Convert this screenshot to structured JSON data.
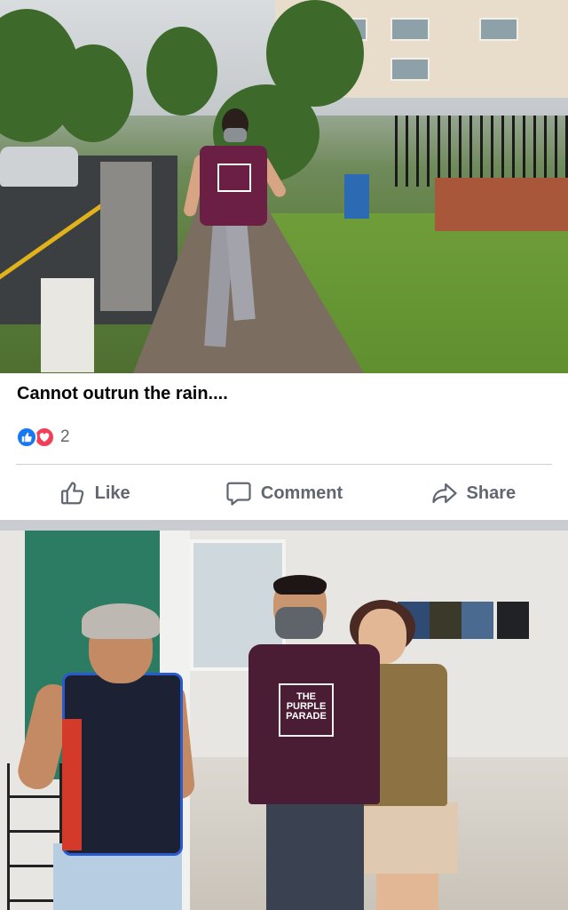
{
  "post": {
    "caption": "Cannot outrun the rain....",
    "reactions": {
      "types": [
        "like",
        "love"
      ],
      "count": "2"
    }
  },
  "actions": {
    "like_label": "Like",
    "comment_label": "Comment",
    "share_label": "Share"
  },
  "photos": {
    "shirt_text": "THE PURPLE PARADE"
  },
  "colors": {
    "like_blue": "#1877f2",
    "love_red": "#f33e58",
    "action_gray": "#606770",
    "divider": "#ced0d4",
    "separator": "#c9ccd1"
  },
  "icons": {
    "like_reaction": "thumbs-up-icon",
    "love_reaction": "heart-icon",
    "like_action": "thumbs-up-outline-icon",
    "comment_action": "speech-bubble-icon",
    "share_action": "share-arrow-icon"
  }
}
